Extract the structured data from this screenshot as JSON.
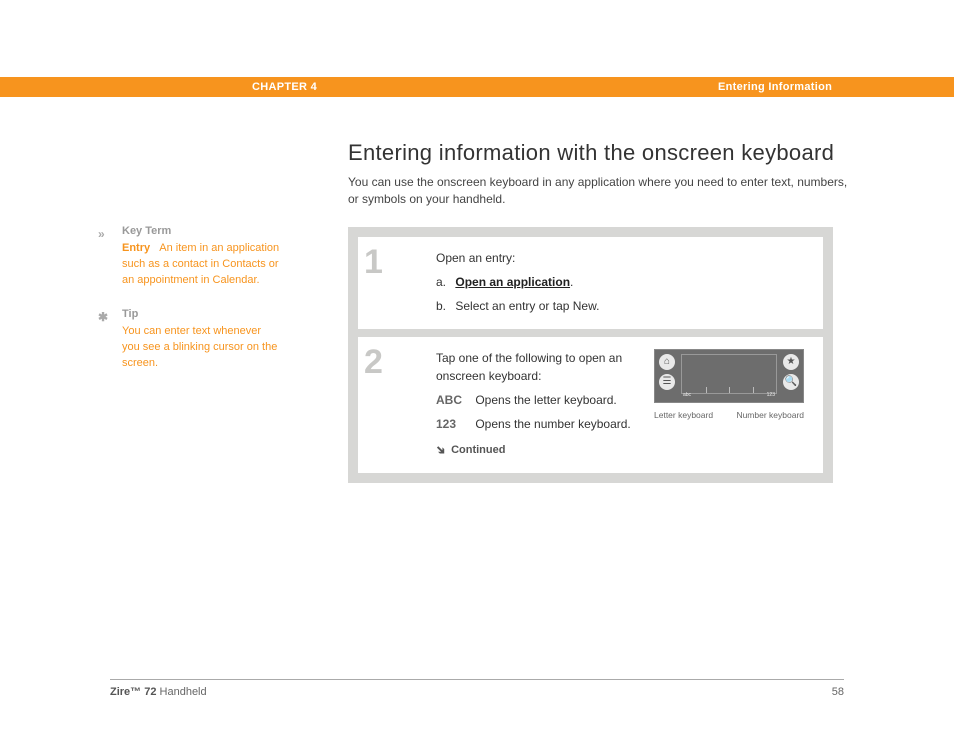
{
  "header": {
    "chapter": "CHAPTER 4",
    "section": "Entering Information"
  },
  "title": "Entering information with the onscreen keyboard",
  "intro": "You can use the onscreen keyboard in any application where you need to enter text, numbers, or symbols on your handheld.",
  "sidebar": {
    "keyterm": {
      "label": "Key Term",
      "term": "Entry",
      "def": "An item in an application such as a contact in Contacts or an appointment in Calendar."
    },
    "tip": {
      "label": "Tip",
      "text": "You can enter text whenever you see a blinking cursor on the screen."
    }
  },
  "steps": {
    "s1": {
      "num": "1",
      "lead": "Open an entry:",
      "a_prefix": "a.",
      "a_link": "Open an application",
      "a_suffix": ".",
      "b_prefix": "b.",
      "b_text": "Select an entry or tap New."
    },
    "s2": {
      "num": "2",
      "lead": "Tap one of the following to open an onscreen keyboard:",
      "abc_label": "ABC",
      "abc_text": "Opens the letter keyboard.",
      "n123_label": "123",
      "n123_text": "Opens the number keyboard.",
      "continued": "Continued",
      "fig": {
        "abc": "abc",
        "n123": "123",
        "left_caption": "Letter keyboard",
        "right_caption": "Number keyboard"
      }
    }
  },
  "footer": {
    "product_bold": "Zire™ 72",
    "product_rest": " Handheld",
    "page": "58"
  }
}
